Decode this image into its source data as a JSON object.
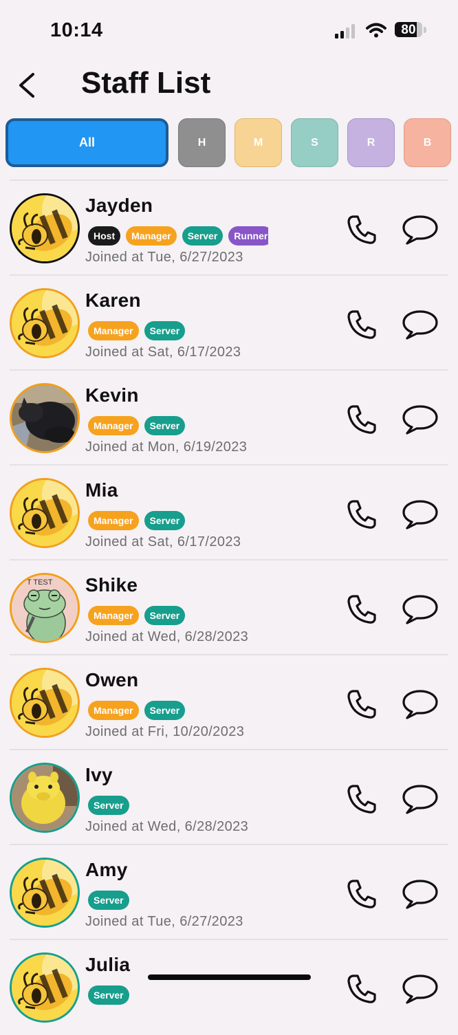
{
  "status_bar": {
    "time": "10:14",
    "battery_level": 0.8,
    "battery_text": "80"
  },
  "header": {
    "title": "Staff List",
    "back_icon": "chevron-left-icon"
  },
  "filters": [
    {
      "label": "All",
      "color": "#2196f3",
      "selected": true
    },
    {
      "label": "H",
      "color": "#8f8f8f",
      "selected": false
    },
    {
      "label": "M",
      "color": "#f8d494",
      "selected": false
    },
    {
      "label": "S",
      "color": "#96cdc5",
      "selected": false
    },
    {
      "label": "R",
      "color": "#c6b2e0",
      "selected": false
    },
    {
      "label": "B",
      "color": "#f6b39f",
      "selected": false
    }
  ],
  "role_colors": {
    "Host": "#1b1b1b",
    "Manager": "#f6a21e",
    "Server": "#179e8c",
    "Runner": "#8856c8"
  },
  "staff": [
    {
      "name": "Jayden",
      "roles": [
        "Host",
        "Manager",
        "Server",
        "Runner"
      ],
      "joined": "Joined at Tue, 6/27/2023",
      "avatar": "bee-avatar",
      "ring": "#111111"
    },
    {
      "name": "Karen",
      "roles": [
        "Manager",
        "Server"
      ],
      "joined": "Joined at Sat, 6/17/2023",
      "avatar": "bee-avatar",
      "ring": "#f0a01c"
    },
    {
      "name": "Kevin",
      "roles": [
        "Manager",
        "Server"
      ],
      "joined": "Joined at Mon, 6/19/2023",
      "avatar": "cat-photo-avatar",
      "ring": "#f0a01c"
    },
    {
      "name": "Mia",
      "roles": [
        "Manager",
        "Server"
      ],
      "joined": "Joined at Sat, 6/17/2023",
      "avatar": "bee-avatar",
      "ring": "#f0a01c"
    },
    {
      "name": "Shike",
      "roles": [
        "Manager",
        "Server"
      ],
      "joined": "Joined at Wed, 6/28/2023",
      "avatar": "frog-avatar",
      "ring": "#f0a01c"
    },
    {
      "name": "Owen",
      "roles": [
        "Manager",
        "Server"
      ],
      "joined": "Joined at Fri, 10/20/2023",
      "avatar": "bee-avatar",
      "ring": "#f0a01c"
    },
    {
      "name": "Ivy",
      "roles": [
        "Server"
      ],
      "joined": "Joined at Wed, 6/28/2023",
      "avatar": "plush-photo-avatar",
      "ring": "#179e8c"
    },
    {
      "name": "Amy",
      "roles": [
        "Server"
      ],
      "joined": "Joined at Tue, 6/27/2023",
      "avatar": "bee-avatar",
      "ring": "#179e8c"
    },
    {
      "name": "Julia",
      "roles": [
        "Server"
      ],
      "joined": "",
      "avatar": "bee-avatar",
      "ring": "#179e8c"
    }
  ],
  "row_actions": {
    "call_icon": "phone-icon",
    "message_icon": "chat-bubble-icon"
  }
}
